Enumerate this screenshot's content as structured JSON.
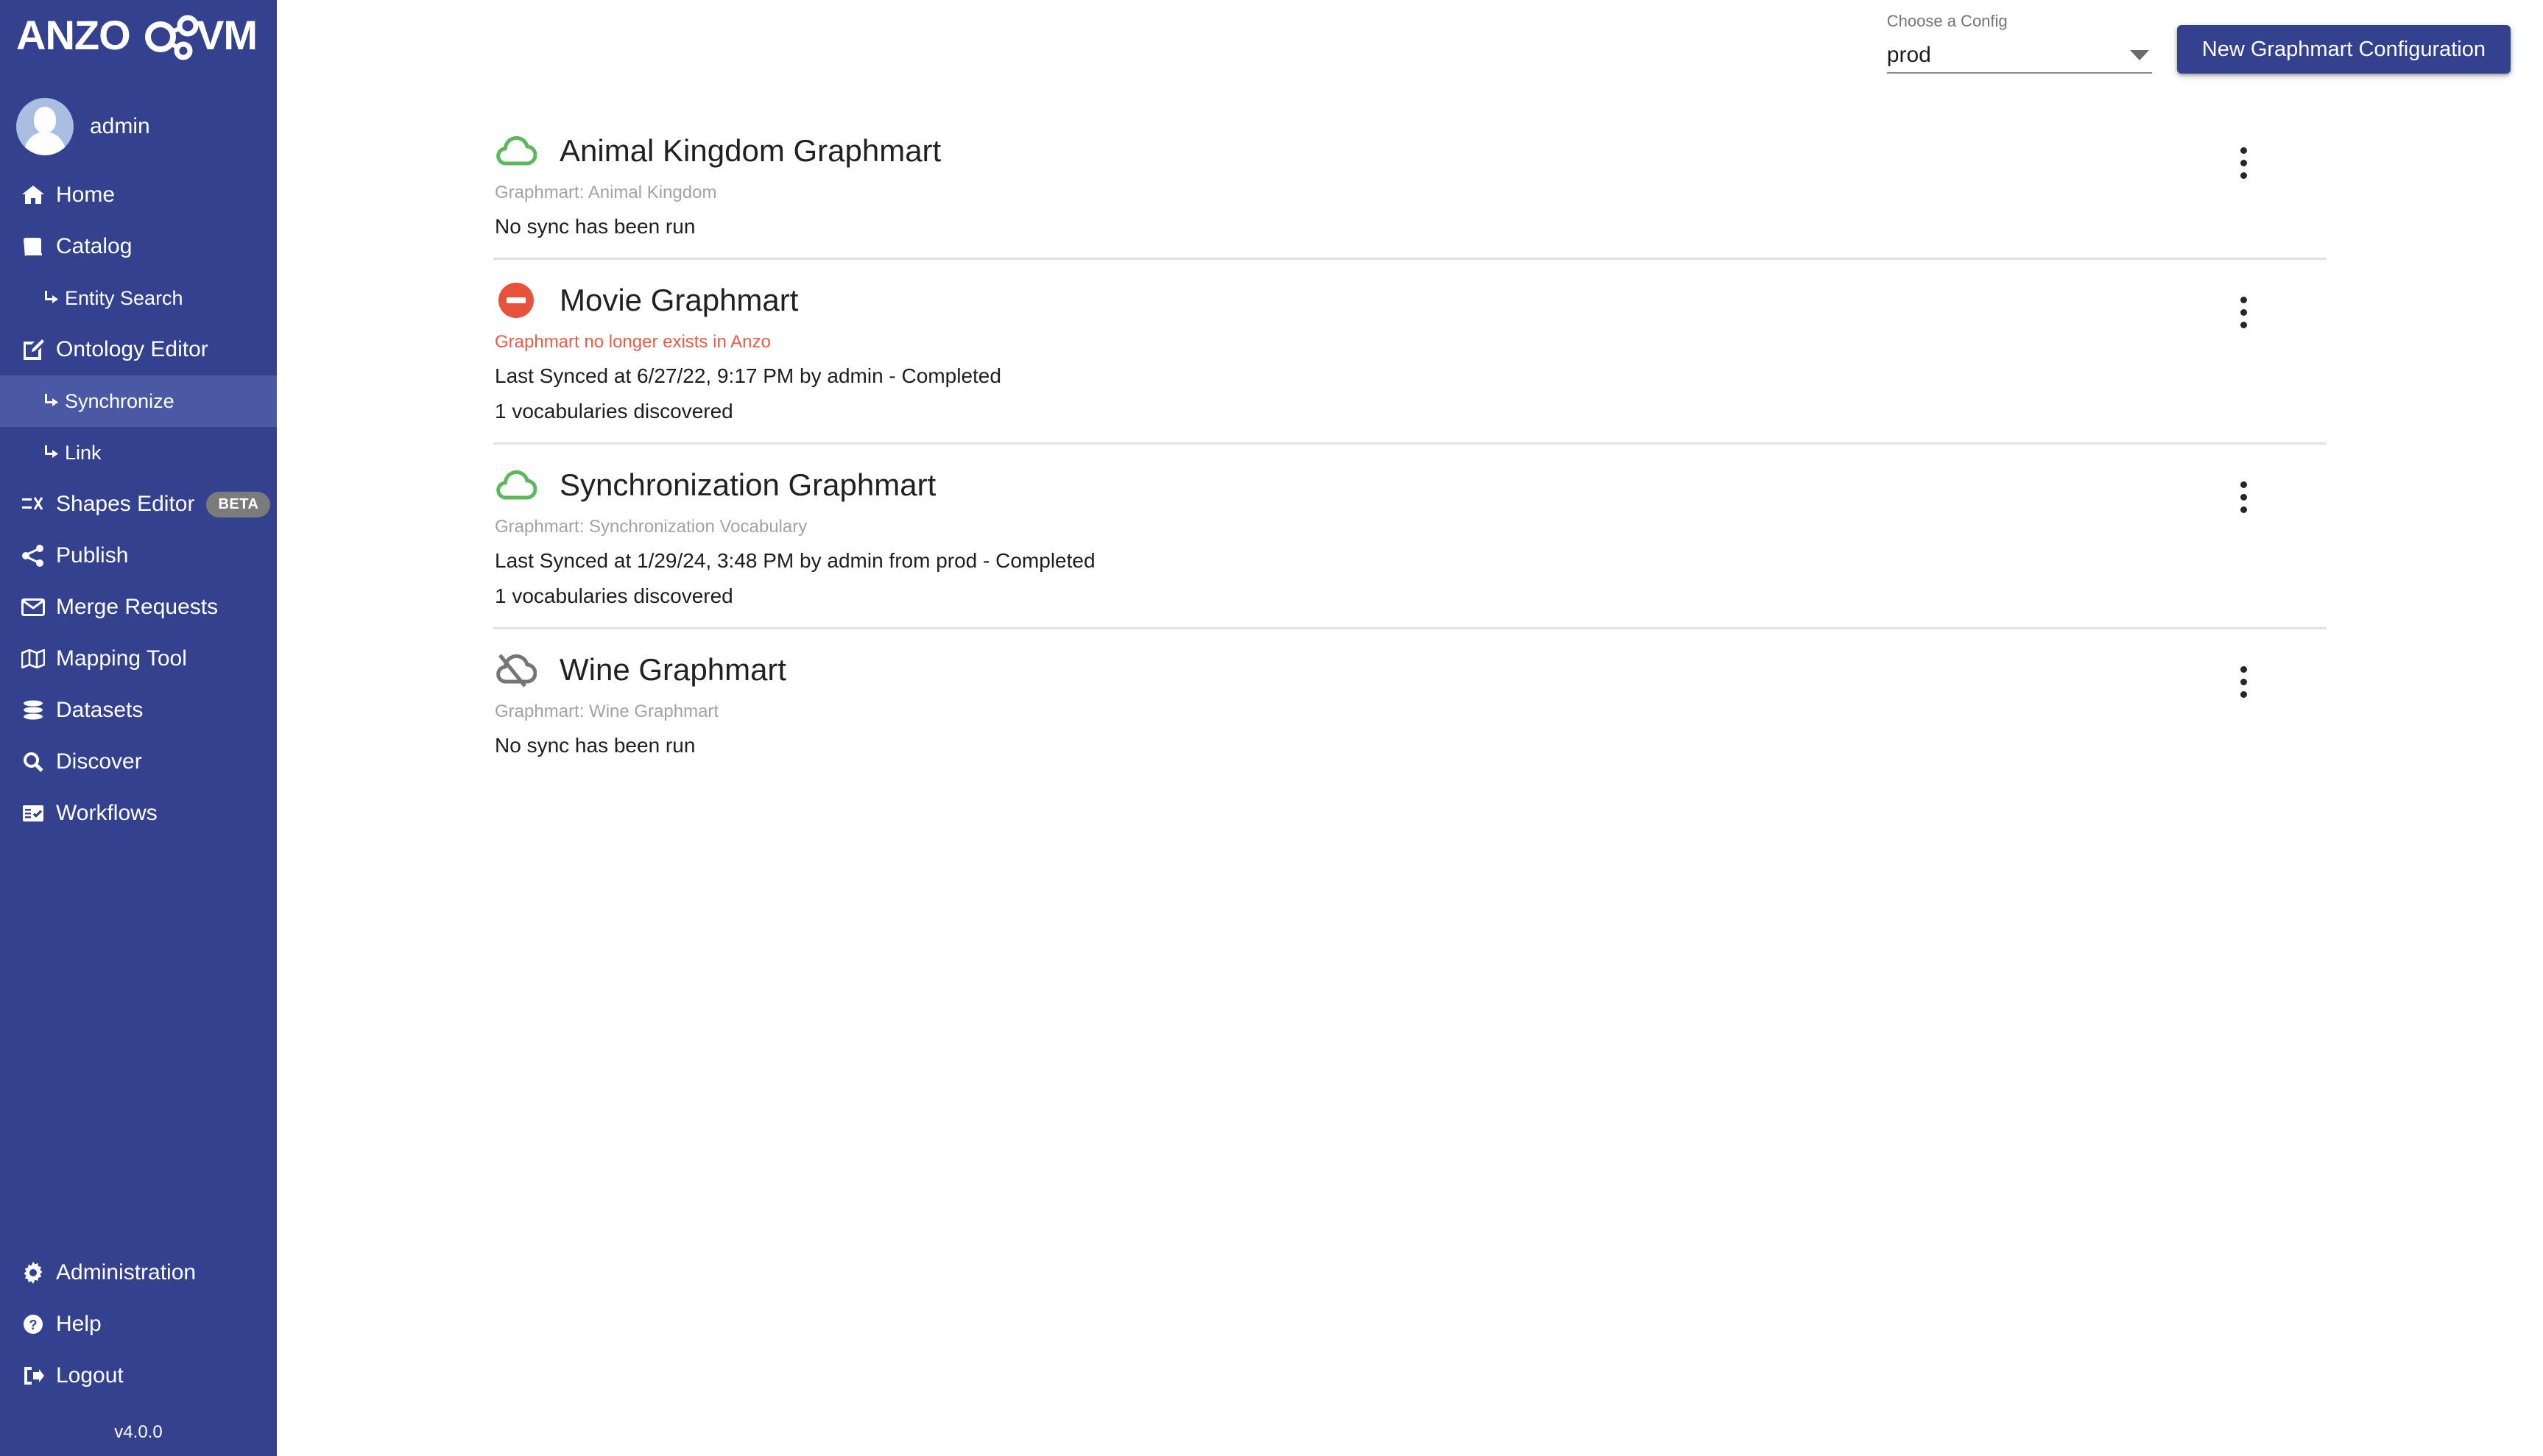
{
  "brand": {
    "logo_text_left": "ANZO",
    "logo_text_right": "VM",
    "sidebar_color": "#34418e",
    "active_color": "#4b59a5",
    "accent_color": "#34418e"
  },
  "user": {
    "name": "admin",
    "avatar_icon": "user-avatar-icon"
  },
  "sidebar": {
    "items": [
      {
        "label": "Home",
        "icon": "home-icon",
        "sub": false,
        "active": false,
        "badge": ""
      },
      {
        "label": "Catalog",
        "icon": "book-icon",
        "sub": false,
        "active": false,
        "badge": ""
      },
      {
        "label": "Entity Search",
        "icon": "arrow-branch-icon",
        "sub": true,
        "active": false,
        "badge": ""
      },
      {
        "label": "Ontology Editor",
        "icon": "edit-square-icon",
        "sub": false,
        "active": false,
        "badge": ""
      },
      {
        "label": "Synchronize",
        "icon": "arrow-branch-icon",
        "sub": true,
        "active": true,
        "badge": ""
      },
      {
        "label": "Link",
        "icon": "arrow-branch-icon",
        "sub": true,
        "active": false,
        "badge": ""
      },
      {
        "label": "Shapes Editor",
        "icon": "shapes-icon",
        "sub": false,
        "active": false,
        "badge": "BETA"
      },
      {
        "label": "Publish",
        "icon": "share-icon",
        "sub": false,
        "active": false,
        "badge": ""
      },
      {
        "label": "Merge Requests",
        "icon": "envelope-icon",
        "sub": false,
        "active": false,
        "badge": ""
      },
      {
        "label": "Mapping Tool",
        "icon": "map-icon",
        "sub": false,
        "active": false,
        "badge": ""
      },
      {
        "label": "Datasets",
        "icon": "database-icon",
        "sub": false,
        "active": false,
        "badge": ""
      },
      {
        "label": "Discover",
        "icon": "search-icon",
        "sub": false,
        "active": false,
        "badge": ""
      },
      {
        "label": "Workflows",
        "icon": "checklist-icon",
        "sub": false,
        "active": false,
        "badge": ""
      }
    ],
    "bottom_items": [
      {
        "label": "Administration",
        "icon": "gear-icon",
        "active": false
      },
      {
        "label": "Help",
        "icon": "help-icon",
        "active": false
      },
      {
        "label": "Logout",
        "icon": "logout-icon",
        "active": false
      }
    ],
    "version": "v4.0.0"
  },
  "topbar": {
    "config_label": "Choose a Config",
    "config_value": "prod",
    "config_options": [
      "prod"
    ],
    "new_config_button": "New Graphmart Configuration"
  },
  "graphmarts": [
    {
      "title": "Animal Kingdom Graphmart",
      "subtitle": "Graphmart: Animal Kingdom",
      "subtitle_is_error": false,
      "status_icon": "cloud-green-icon",
      "status_color": "#5cb85c",
      "lines": [
        "No sync has been run"
      ],
      "menu_icon": "more-vertical-icon"
    },
    {
      "title": "Movie Graphmart",
      "subtitle": "Graphmart no longer exists in Anzo",
      "subtitle_is_error": true,
      "status_icon": "minus-circle-red-icon",
      "status_color": "#e8513a",
      "lines": [
        "Last Synced at 6/27/22, 9:17 PM by admin - Completed",
        "1 vocabularies discovered"
      ],
      "menu_icon": "more-vertical-icon"
    },
    {
      "title": "Synchronization Graphmart",
      "subtitle": "Graphmart: Synchronization Vocabulary",
      "subtitle_is_error": false,
      "status_icon": "cloud-green-icon",
      "status_color": "#5cb85c",
      "lines": [
        "Last Synced at 1/29/24, 3:48 PM by admin from prod - Completed",
        "1 vocabularies discovered"
      ],
      "menu_icon": "more-vertical-icon"
    },
    {
      "title": "Wine Graphmart",
      "subtitle": "Graphmart: Wine Graphmart",
      "subtitle_is_error": false,
      "status_icon": "cloud-off-gray-icon",
      "status_color": "#757575",
      "lines": [
        "No sync has been run"
      ],
      "menu_icon": "more-vertical-icon"
    }
  ]
}
